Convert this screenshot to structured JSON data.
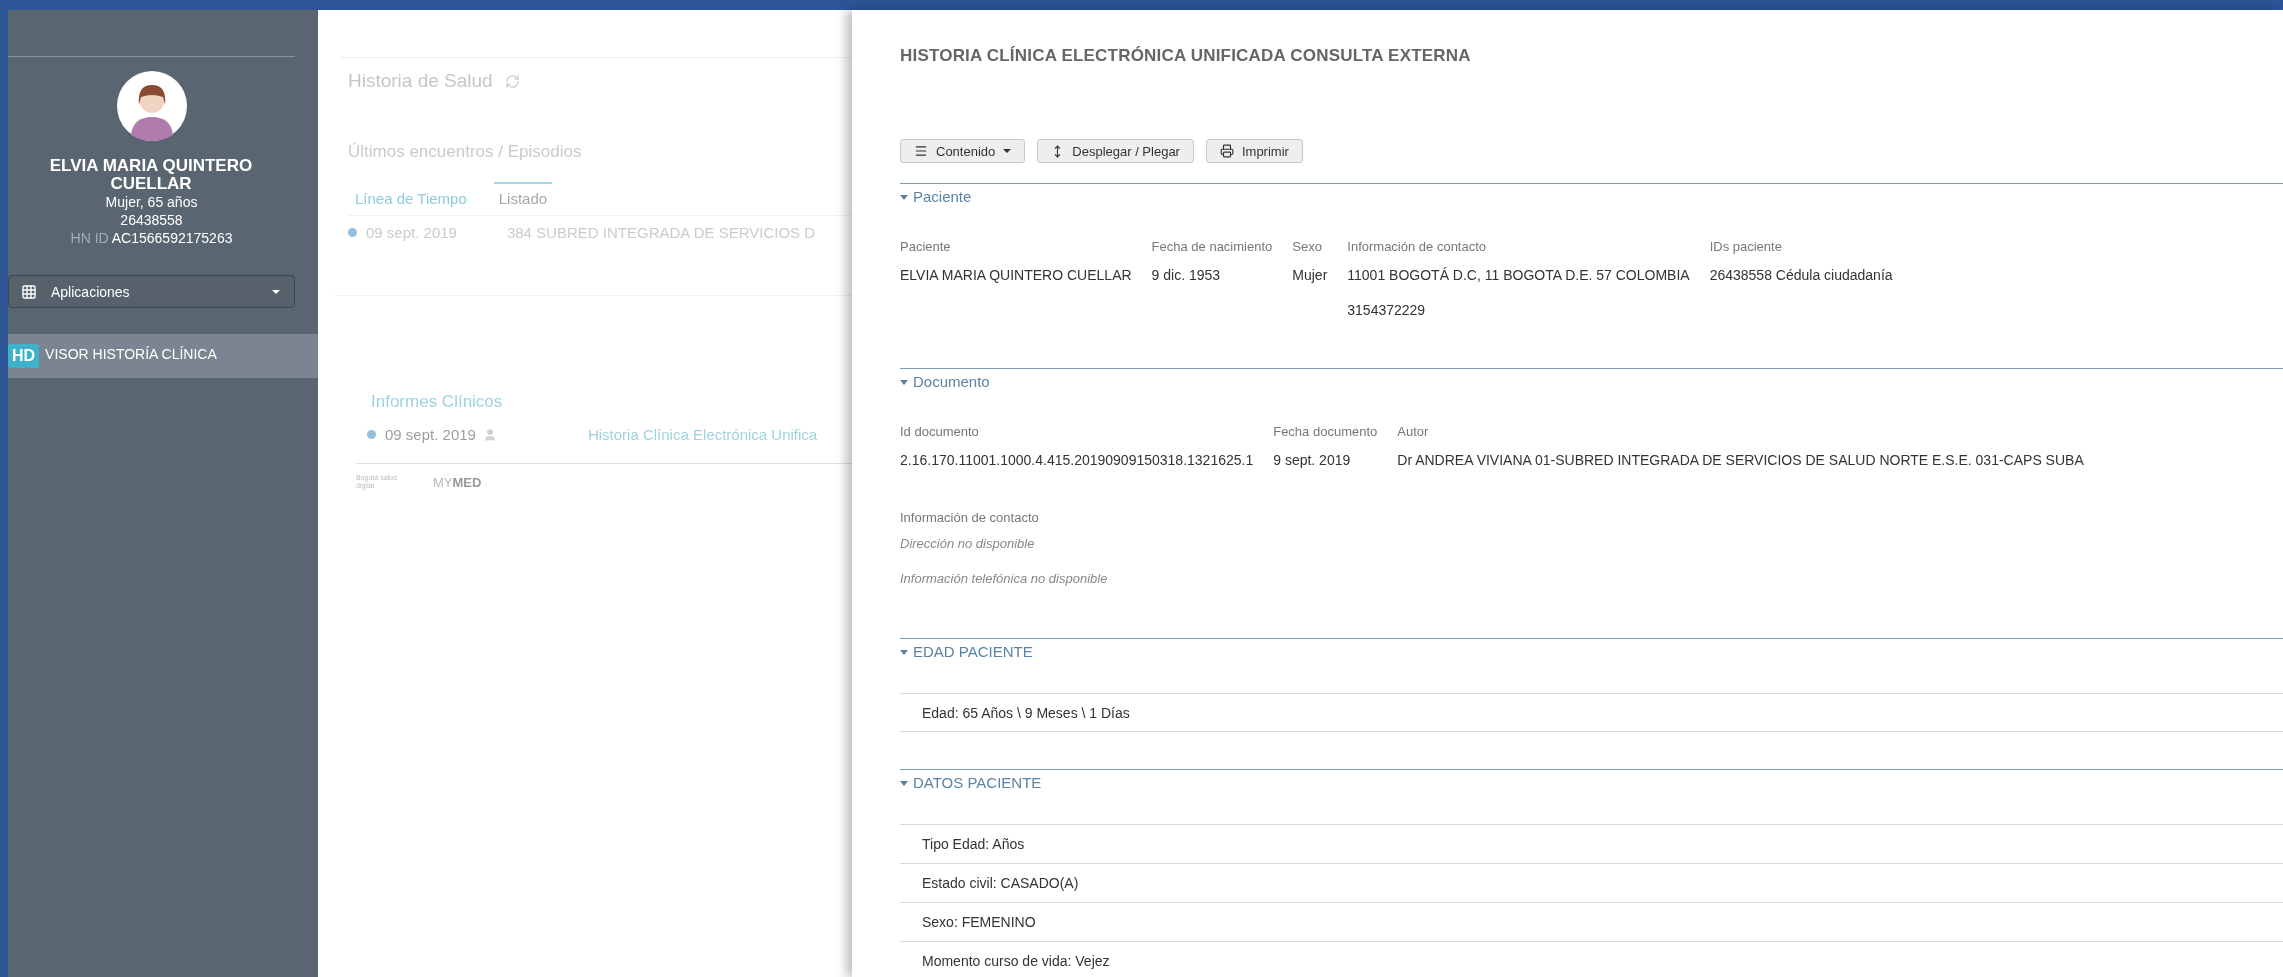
{
  "sidebar": {
    "patient_name": "ELVIA MARIA QUINTERO CUELLAR",
    "gender_age": "Mujer, 65 años",
    "document_number": "26438558",
    "hn_id_label": "HN ID",
    "hn_id": "AC1566592175263",
    "apps_menu": {
      "label": "Aplicaciones"
    },
    "items": [
      {
        "badge": "HD",
        "label": "VISOR HISTORÍA CLÍNICA",
        "selected": true
      }
    ]
  },
  "background_page": {
    "title": "Historia de Salud",
    "encounters_heading": "Últimos encuentros / Episodios",
    "tabs": [
      {
        "label": "Línea de Tiempo",
        "selected": false
      },
      {
        "label": "Listado",
        "selected": true
      }
    ],
    "encounters": [
      {
        "date": "09 sept. 2019",
        "description": "384 SUBRED INTEGRADA DE SERVICIOS D"
      }
    ],
    "reports_heading": "Informes Clínicos",
    "reports": [
      {
        "date": "09 sept. 2019",
        "title": "Historia Clínica Electrónica Unifica"
      }
    ],
    "footer": {
      "logo_text": "Bogotá salud digital",
      "brand": "MY**MED**"
    }
  },
  "document": {
    "title": "HISTORIA CLÍNICA ELECTRÓNICA UNIFICADA CONSULTA EXTERNA",
    "toolbar": [
      {
        "label": "Contenido",
        "kind": "dropdown"
      },
      {
        "label": "Desplegar / Plegar",
        "kind": "toggle"
      },
      {
        "label": "Imprimir",
        "kind": "print"
      }
    ],
    "sections": [
      {
        "title": "Paciente",
        "expanded": true,
        "kind": "fields",
        "columns": [
          {
            "label": "Paciente",
            "values": [
              "ELVIA MARIA QUINTERO CUELLAR"
            ]
          },
          {
            "label": "Fecha de nacimiento",
            "values": [
              "9 dic. 1953"
            ]
          },
          {
            "label": "Sexo",
            "values": [
              "Mujer"
            ]
          },
          {
            "label": "Información de contacto",
            "values": [
              "11001 BOGOTÁ D.C, 11 BOGOTA D.E. 57 COLOMBIA",
              "3154372229"
            ]
          },
          {
            "label": "IDs paciente",
            "values": [
              "26438558 Cédula ciudadanía"
            ]
          }
        ]
      },
      {
        "title": "Documento",
        "expanded": true,
        "kind": "fields",
        "columns": [
          {
            "label": "Id documento",
            "values": [
              "2.16.170.11001.1000.4.415.20190909150318.1321625.1"
            ]
          },
          {
            "label": "Fecha documento",
            "values": [
              "9 sept. 2019"
            ]
          },
          {
            "label": "Autor",
            "values": [
              "Dr ANDREA VIVIANA 01-SUBRED INTEGRADA DE SERVICIOS DE SALUD NORTE E.S.E. 031-CAPS SUBA"
            ]
          }
        ],
        "contact": {
          "label": "Información de contacto",
          "notes": [
            "Dirección no disponible",
            "Información telefónica no disponible"
          ]
        }
      },
      {
        "title": "EDAD PACIENTE",
        "expanded": true,
        "kind": "rows",
        "rows": [
          "Edad: 65 Años \\ 9 Meses \\ 1 Días"
        ]
      },
      {
        "title": "DATOS PACIENTE",
        "expanded": true,
        "kind": "rows",
        "rows": [
          "Tipo Edad: Años",
          "Estado civil: CASADO(A)",
          "Sexo: FEMENINO",
          "Momento curso de vida: Vejez"
        ]
      }
    ]
  }
}
